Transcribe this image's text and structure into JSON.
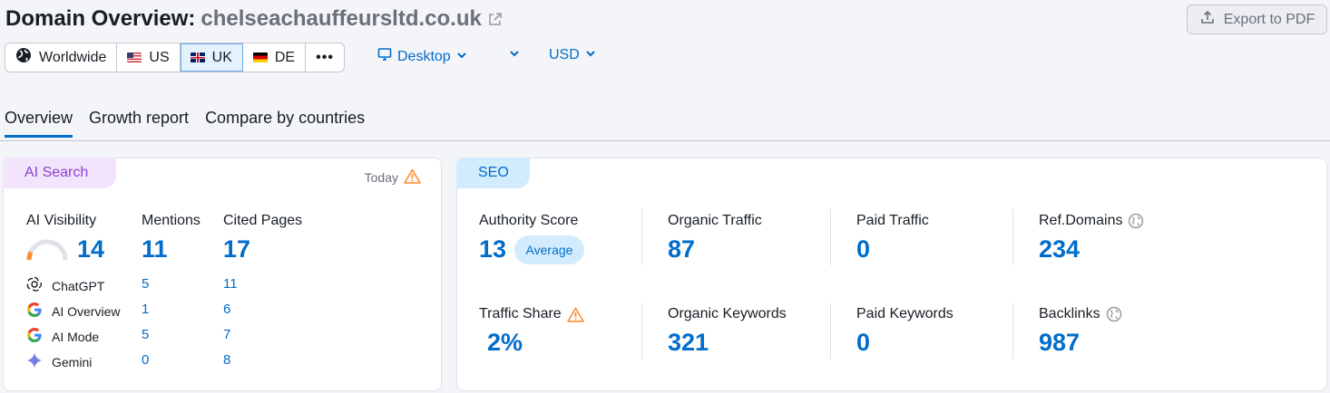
{
  "header": {
    "title": "Domain Overview:",
    "domain": "chelseachauffeursltd.co.uk",
    "export_label": "Export to PDF"
  },
  "regions": {
    "items": [
      {
        "label": "Worldwide",
        "icon": "globe-icon"
      },
      {
        "label": "US",
        "icon": "flag-us-icon"
      },
      {
        "label": "UK",
        "icon": "flag-uk-icon",
        "active": true
      },
      {
        "label": "DE",
        "icon": "flag-de-icon"
      }
    ],
    "more": "•••"
  },
  "device": {
    "label": "Desktop"
  },
  "currency": {
    "label": "USD"
  },
  "tabs": [
    {
      "label": "Overview",
      "active": true
    },
    {
      "label": "Growth report"
    },
    {
      "label": "Compare by countries"
    }
  ],
  "ai_search": {
    "badge": "AI Search",
    "today": "Today",
    "columns": {
      "visibility": {
        "label": "AI Visibility",
        "value": "14",
        "gauge_fraction": 0.14
      },
      "mentions": {
        "label": "Mentions",
        "value": "11"
      },
      "cited": {
        "label": "Cited Pages",
        "value": "17"
      }
    },
    "rows": [
      {
        "name": "ChatGPT",
        "mentions": "5",
        "cited": "11"
      },
      {
        "name": "AI Overview",
        "mentions": "1",
        "cited": "6"
      },
      {
        "name": "AI Mode",
        "mentions": "5",
        "cited": "7"
      },
      {
        "name": "Gemini",
        "mentions": "0",
        "cited": "8"
      }
    ]
  },
  "seo": {
    "badge": "SEO",
    "authority": {
      "label": "Authority Score",
      "value": "13",
      "pill": "Average"
    },
    "organic_traffic": {
      "label": "Organic Traffic",
      "value": "87"
    },
    "paid_traffic": {
      "label": "Paid Traffic",
      "value": "0"
    },
    "ref_domains": {
      "label": "Ref.Domains",
      "value": "234"
    },
    "traffic_share": {
      "label": "Traffic Share",
      "value": "2%"
    },
    "organic_keywords": {
      "label": "Organic Keywords",
      "value": "321"
    },
    "paid_keywords": {
      "label": "Paid Keywords",
      "value": "0"
    },
    "backlinks": {
      "label": "Backlinks",
      "value": "987"
    }
  },
  "colors": {
    "accent": "#006dca",
    "ai_badge": "#8c3fcf",
    "warning": "#ff8c2a"
  }
}
